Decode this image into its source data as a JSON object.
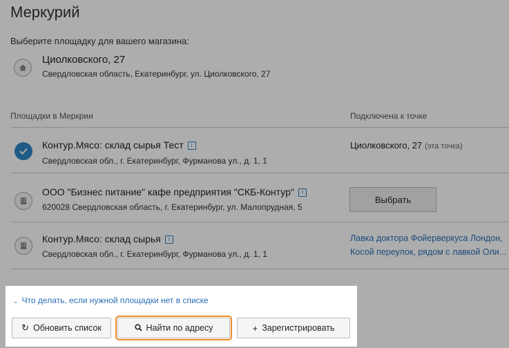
{
  "page": {
    "title": "Меркурий",
    "subtitle": "Выберите площадку для вашего магазина:"
  },
  "store": {
    "name": "Циолковского, 27",
    "address": "Свердловская область, Екатеринбург, ул. Циолковского, 27",
    "icon": "house-icon"
  },
  "columns": {
    "sites": "Площадки в Меркрии",
    "connected": "Подключена к точке"
  },
  "rows": [
    {
      "name": "Контур.Мясо: склад сырья Тест",
      "address": "Свердловская обл., г. Екатеринбург, Фурманова ул., д. 1, 1",
      "connected_name": "Циолковского, 27",
      "connected_note": "(эта точка)",
      "selected": true
    },
    {
      "name": "ООО \"Бизнес питание\" кафе предприятия \"СКБ-Контур\"",
      "address": "620028 Свердловская область, г. Екатеринбург, ул. Малопрудная, 5",
      "action_label": "Выбрать",
      "selected": false
    },
    {
      "name": "Контур.Мясо: склад сырья",
      "address": "Свердловская обл., г. Екатеринбург, Фурманова ул., д. 1, 1",
      "connected_link_line1": "Лавка доктора Фойерверкуса Лондон,",
      "connected_link_line2": "Косой переулок, рядом с лавкой Оли...",
      "selected": false
    }
  ],
  "info_icon_glyph": "i",
  "panel": {
    "help_link": "Что делать, если нужной площадки нет в списке",
    "refresh_label": "Обновить список",
    "find_label": "Найти по адресу",
    "register_label": "Зарегистрировать"
  },
  "colors": {
    "accent": "#2f86c8",
    "link": "#2a6fb5",
    "highlight": "#f08a24"
  }
}
